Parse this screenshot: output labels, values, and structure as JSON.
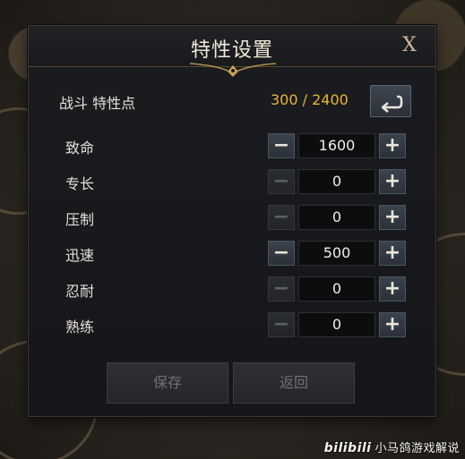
{
  "dialog": {
    "title": "特性设置",
    "close_label": "X",
    "points_label": "战斗 特性点",
    "points_value": "300 / 2400",
    "reset_icon": "reset-arrow-icon"
  },
  "stats": [
    {
      "name": "致命",
      "value": "1600",
      "minus_enabled": true
    },
    {
      "name": "专长",
      "value": "0",
      "minus_enabled": false
    },
    {
      "name": "压制",
      "value": "0",
      "minus_enabled": false
    },
    {
      "name": "迅速",
      "value": "500",
      "minus_enabled": true
    },
    {
      "name": "忍耐",
      "value": "0",
      "minus_enabled": false
    },
    {
      "name": "熟练",
      "value": "0",
      "minus_enabled": false
    }
  ],
  "controls": {
    "minus_glyph": "−",
    "plus_glyph": "+"
  },
  "footer": {
    "save_label": "保存",
    "back_label": "返回"
  },
  "watermark": {
    "logo_text": "bilibili",
    "channel": "小马鸽游戏解说"
  },
  "colors": {
    "accent_gold": "#e8b634",
    "dialog_bg": "#17181c"
  }
}
